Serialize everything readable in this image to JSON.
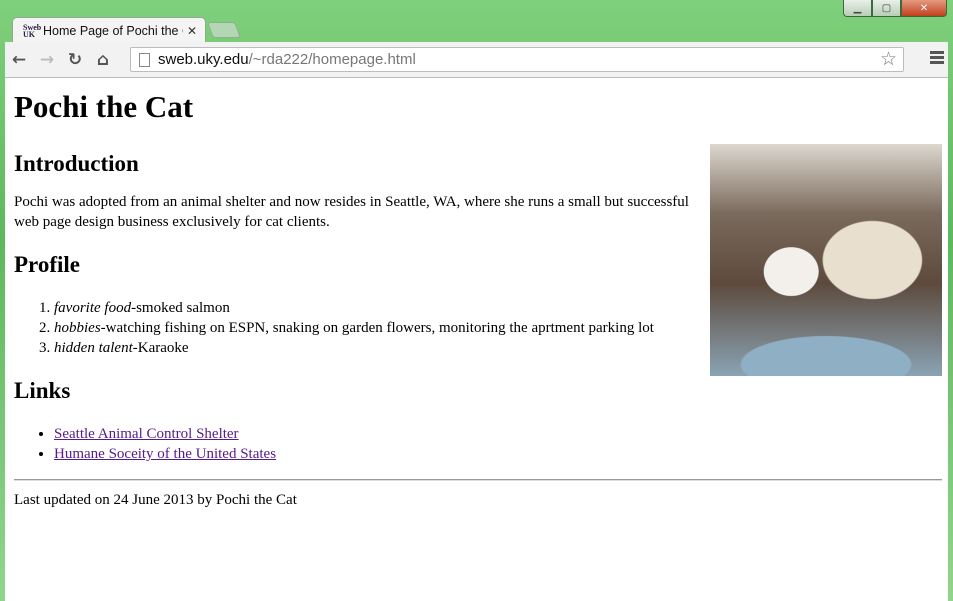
{
  "browser": {
    "tab_title": "Home Page of Pochi the Cat",
    "favicon_text": "Sweb UK",
    "url_host": "sweb.uky.edu",
    "url_path": "/~rda222/homepage.html",
    "icons": [
      "back-icon",
      "forward-icon",
      "reload-icon",
      "home-icon",
      "page-icon",
      "star-icon",
      "menu-icon",
      "minimize-icon",
      "maximize-icon",
      "close-icon"
    ]
  },
  "page": {
    "title": "Pochi the Cat",
    "intro_heading": "Introduction",
    "intro_text": "Pochi was adopted from an animal shelter and now resides in Seattle, WA, where she runs a small but successful web page design business exclusively for cat clients.",
    "profile_heading": "Profile",
    "profile": [
      {
        "label": "favorite food",
        "value": "-smoked salmon"
      },
      {
        "label": "hobbies",
        "value": "-watching fishing on ESPN, snaking on garden flowers, monitoring the aprtment parking lot"
      },
      {
        "label": "hidden talent",
        "value": "-Karaoke"
      }
    ],
    "links_heading": "Links",
    "links": [
      "Seattle Animal Control Shelter",
      "Humane Soceity of the United States"
    ],
    "footer": "Last updated on 24 June 2013 by Pochi the Cat"
  }
}
